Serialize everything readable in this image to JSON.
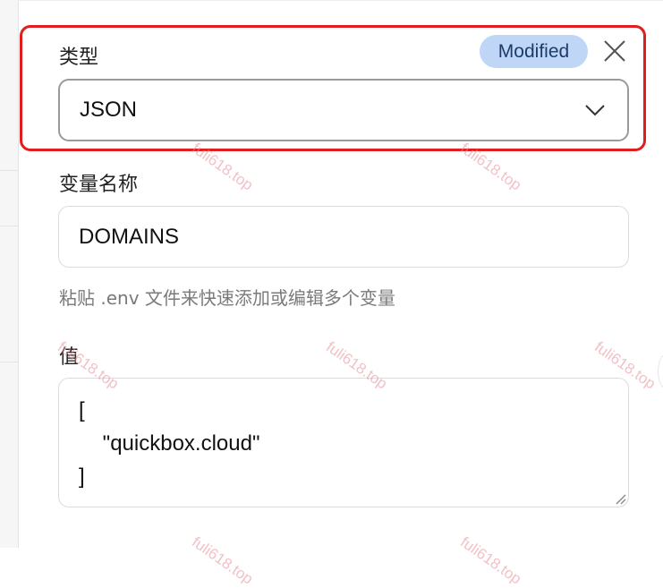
{
  "type_field": {
    "label": "类型",
    "status_badge": "Modified",
    "selected_value": "JSON"
  },
  "name_field": {
    "label": "变量名称",
    "value": "DOMAINS"
  },
  "helper_text": "粘贴 .env 文件来快速添加或编辑多个变量",
  "value_field": {
    "label": "值",
    "value": "[\n    \"quickbox.cloud\"\n]"
  },
  "watermark": "fuli618.top",
  "colors": {
    "badge_bg": "#bfd6f7",
    "badge_text": "#1c3b6b",
    "highlight_border": "#e11d1d",
    "watermark": "#e88c96"
  },
  "icons": {
    "close": "close-icon",
    "dropdown": "chevron-down-icon",
    "resize": "resize-handle-icon"
  }
}
